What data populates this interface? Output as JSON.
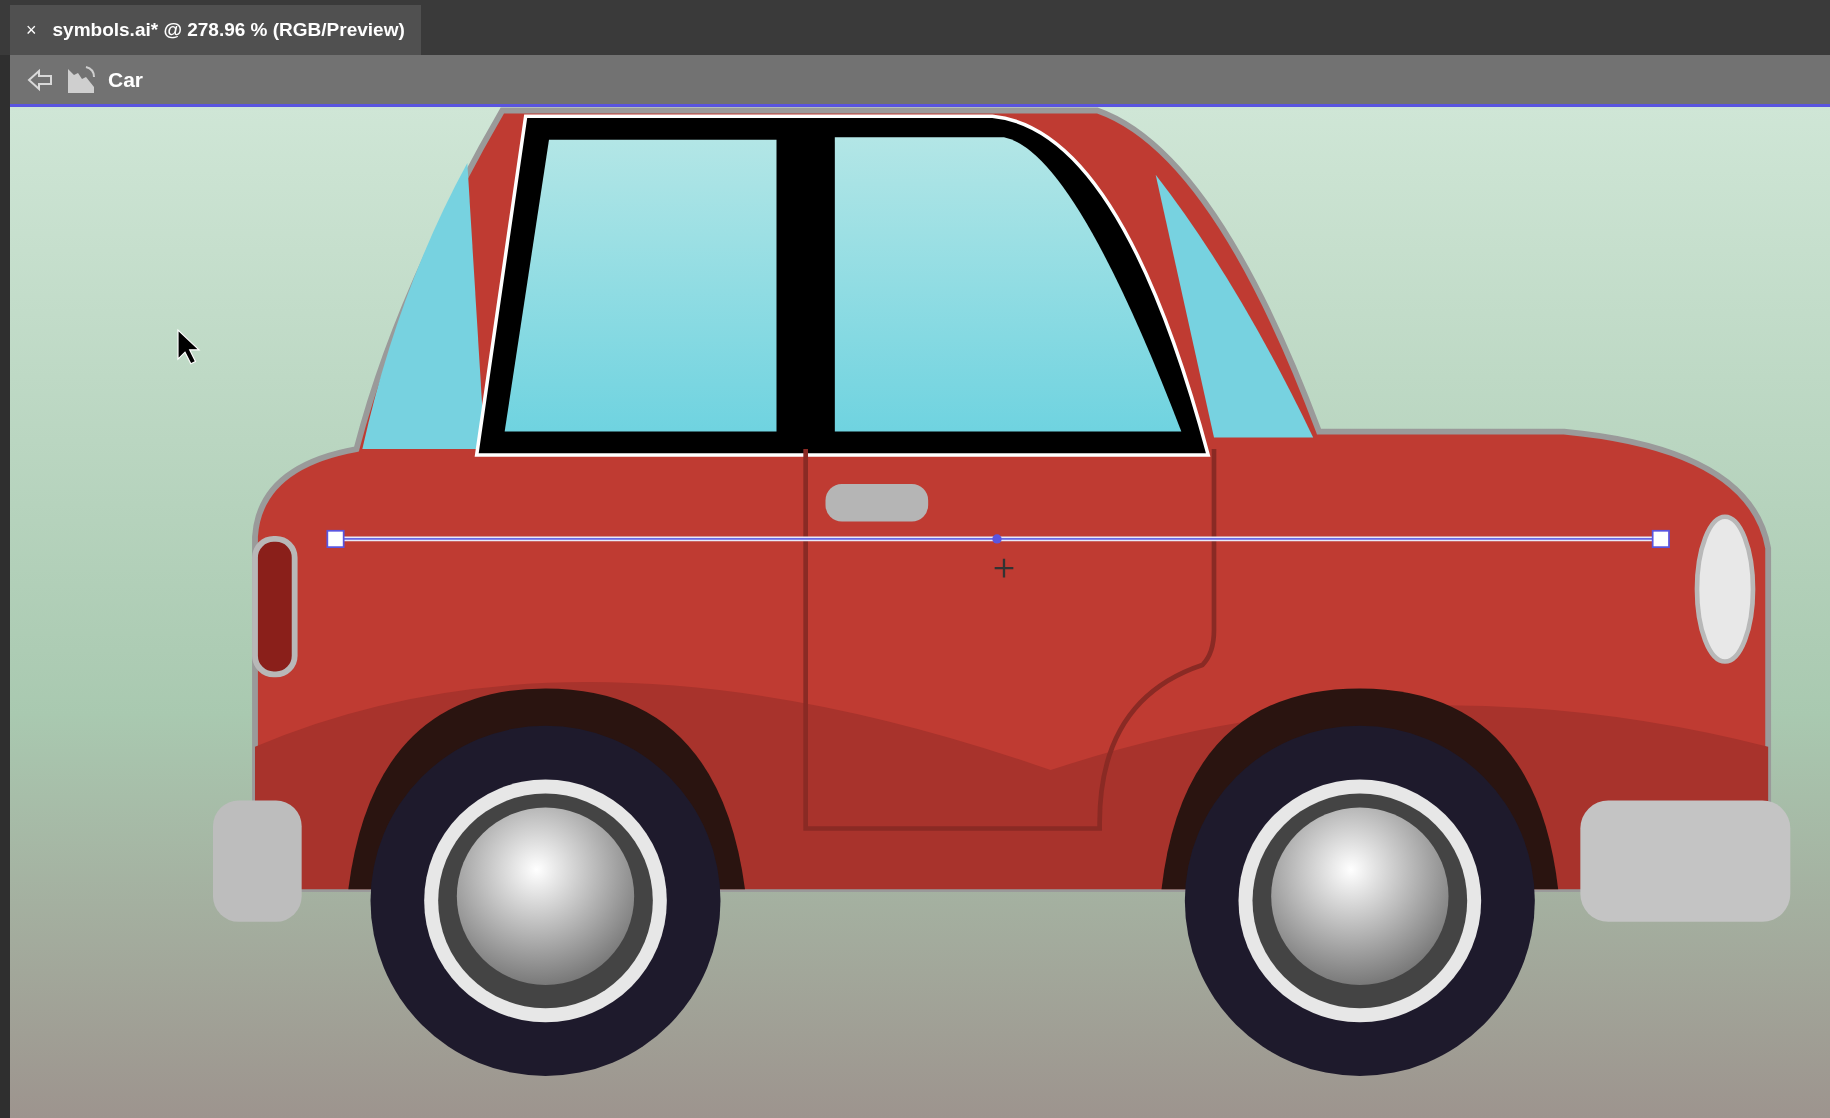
{
  "document_tab": {
    "close": "×",
    "title": "symbols.ai* @ 278.96 % (RGB/Preview)",
    "selected": true
  },
  "isolation_bar": {
    "label": "Car"
  }
}
